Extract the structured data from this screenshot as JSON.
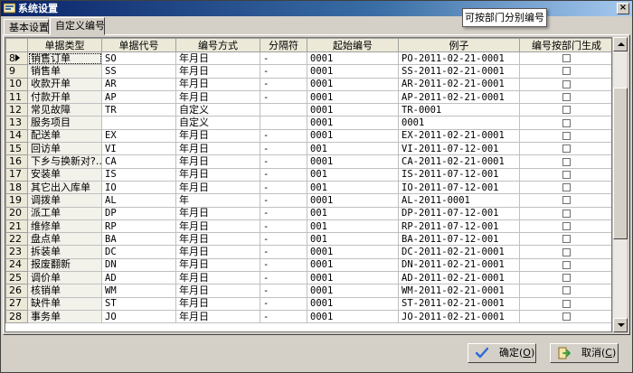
{
  "window": {
    "title": "系统设置",
    "close_glyph": "×"
  },
  "tabs": [
    {
      "label": "基本设置",
      "active": false
    },
    {
      "label": "自定义编号",
      "active": true
    }
  ],
  "tooltip": {
    "text": "可按部门分别编号"
  },
  "table": {
    "columns": [
      "",
      "单据类型",
      "单据代号",
      "编号方式",
      "分隔符",
      "起始编号",
      "例子",
      "编号按部门生成"
    ],
    "selected_row": 8,
    "rows": [
      {
        "num": "8",
        "type": "销售订单",
        "code": "SO",
        "method": "年月日",
        "sep": "-",
        "start": "0001",
        "example": "PO-2011-02-21-0001",
        "by_dept": false
      },
      {
        "num": "9",
        "type": "销售单",
        "code": "SS",
        "method": "年月日",
        "sep": "-",
        "start": "0001",
        "example": "SS-2011-02-21-0001",
        "by_dept": false
      },
      {
        "num": "10",
        "type": "收款开单",
        "code": "AR",
        "method": "年月日",
        "sep": "-",
        "start": "0001",
        "example": "AR-2011-02-21-0001",
        "by_dept": false
      },
      {
        "num": "11",
        "type": "付款开单",
        "code": "AP",
        "method": "年月日",
        "sep": "-",
        "start": "0001",
        "example": "AP-2011-02-21-0001",
        "by_dept": false
      },
      {
        "num": "12",
        "type": "常见故障",
        "code": "TR",
        "method": "自定义",
        "sep": "",
        "start": "0001",
        "example": "TR-0001",
        "by_dept": false
      },
      {
        "num": "13",
        "type": "服务项目",
        "code": "",
        "method": "自定义",
        "sep": "",
        "start": "0001",
        "example": "0001",
        "by_dept": false
      },
      {
        "num": "14",
        "type": "配送单",
        "code": "EX",
        "method": "年月日",
        "sep": "-",
        "start": "0001",
        "example": "EX-2011-02-21-0001",
        "by_dept": false
      },
      {
        "num": "15",
        "type": "回访单",
        "code": "VI",
        "method": "年月日",
        "sep": "-",
        "start": "001",
        "example": "VI-2011-07-12-001",
        "by_dept": false
      },
      {
        "num": "16",
        "type": "下乡与换新对?..",
        "code": "CA",
        "method": "年月日",
        "sep": "-",
        "start": "0001",
        "example": "CA-2011-02-21-0001",
        "by_dept": false
      },
      {
        "num": "17",
        "type": "安装单",
        "code": "IS",
        "method": "年月日",
        "sep": "-",
        "start": "001",
        "example": "IS-2011-07-12-001",
        "by_dept": false
      },
      {
        "num": "18",
        "type": "其它出入库单",
        "code": "IO",
        "method": "年月日",
        "sep": "-",
        "start": "001",
        "example": "IO-2011-07-12-001",
        "by_dept": false
      },
      {
        "num": "19",
        "type": "调拨单",
        "code": "AL",
        "method": "年",
        "sep": "-",
        "start": "0001",
        "example": "AL-2011-0001",
        "by_dept": false
      },
      {
        "num": "20",
        "type": "派工单",
        "code": "DP",
        "method": "年月日",
        "sep": "-",
        "start": "001",
        "example": "DP-2011-07-12-001",
        "by_dept": false
      },
      {
        "num": "21",
        "type": "维修单",
        "code": "RP",
        "method": "年月日",
        "sep": "-",
        "start": "001",
        "example": "RP-2011-07-12-001",
        "by_dept": false
      },
      {
        "num": "22",
        "type": "盘点单",
        "code": "BA",
        "method": "年月日",
        "sep": "-",
        "start": "001",
        "example": "BA-2011-07-12-001",
        "by_dept": false
      },
      {
        "num": "23",
        "type": "拆装单",
        "code": "DC",
        "method": "年月日",
        "sep": "-",
        "start": "0001",
        "example": "DC-2011-02-21-0001",
        "by_dept": false
      },
      {
        "num": "24",
        "type": "报废翻新",
        "code": "DN",
        "method": "年月日",
        "sep": "-",
        "start": "0001",
        "example": "DN-2011-02-21-0001",
        "by_dept": false
      },
      {
        "num": "25",
        "type": "调价单",
        "code": "AD",
        "method": "年月日",
        "sep": "-",
        "start": "0001",
        "example": "AD-2011-02-21-0001",
        "by_dept": false
      },
      {
        "num": "26",
        "type": "核销单",
        "code": "WM",
        "method": "年月日",
        "sep": "-",
        "start": "0001",
        "example": "WM-2011-02-21-0001",
        "by_dept": false
      },
      {
        "num": "27",
        "type": "缺件单",
        "code": "ST",
        "method": "年月日",
        "sep": "-",
        "start": "0001",
        "example": "ST-2011-02-21-0001",
        "by_dept": false
      },
      {
        "num": "28",
        "type": "事务单",
        "code": "JO",
        "method": "年月日",
        "sep": "-",
        "start": "0001",
        "example": "JO-2011-02-21-0001",
        "by_dept": false
      }
    ]
  },
  "buttons": {
    "ok": {
      "label": "确定",
      "hotkey": "O"
    },
    "cancel": {
      "label": "取消",
      "hotkey": "C"
    }
  },
  "colors": {
    "titlebar": "#0a246a",
    "face": "#d4d0c8",
    "ok_icon": "#2a6ad8",
    "cancel_icon": "#2f9a3a"
  },
  "icons": {
    "title": "settings-window-icon",
    "ok": "checkmark-icon",
    "cancel": "exit-door-icon"
  }
}
